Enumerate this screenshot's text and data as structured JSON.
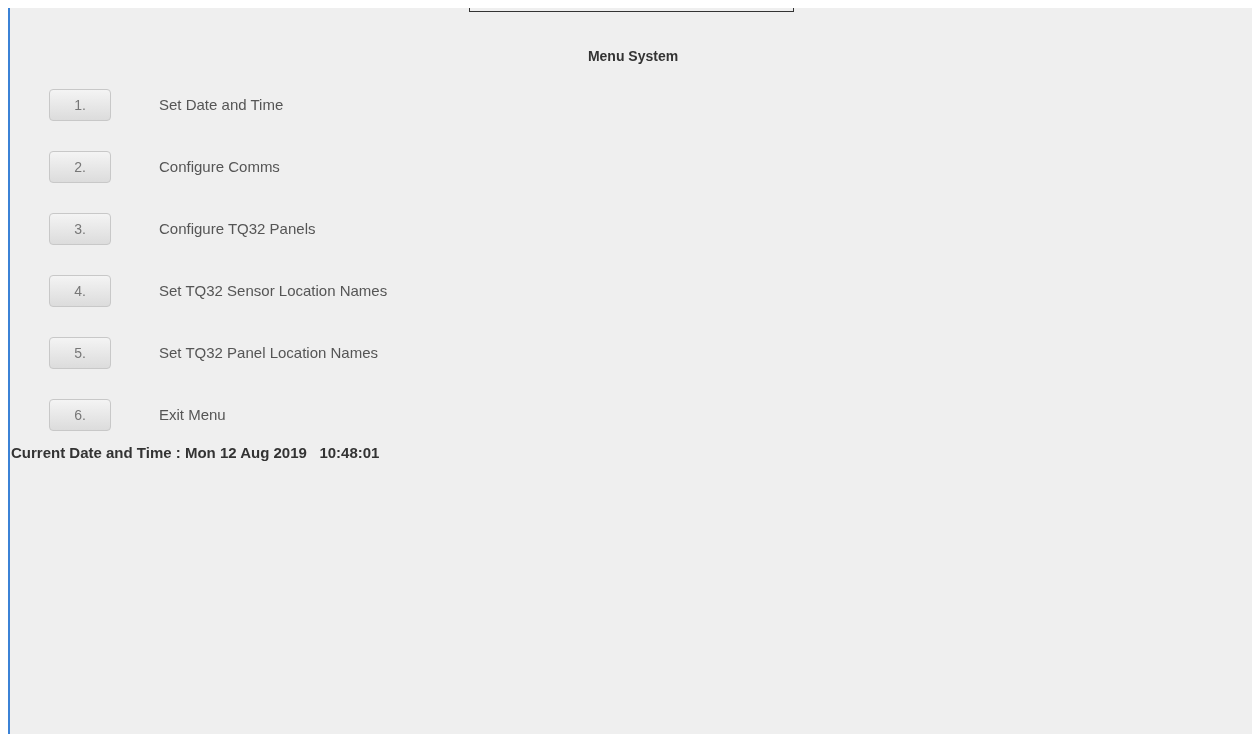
{
  "title": "Menu System",
  "menu_items": [
    {
      "number": "1.",
      "label": "Set Date and Time"
    },
    {
      "number": "2.",
      "label": "Configure Comms"
    },
    {
      "number": "3.",
      "label": "Configure TQ32 Panels"
    },
    {
      "number": "4.",
      "label": "Set TQ32 Sensor Location Names"
    },
    {
      "number": "5.",
      "label": "Set TQ32 Panel Location Names"
    },
    {
      "number": "6.",
      "label": "Exit Menu"
    }
  ],
  "status": "Current Date and Time : Mon 12 Aug 2019   10:48:01"
}
